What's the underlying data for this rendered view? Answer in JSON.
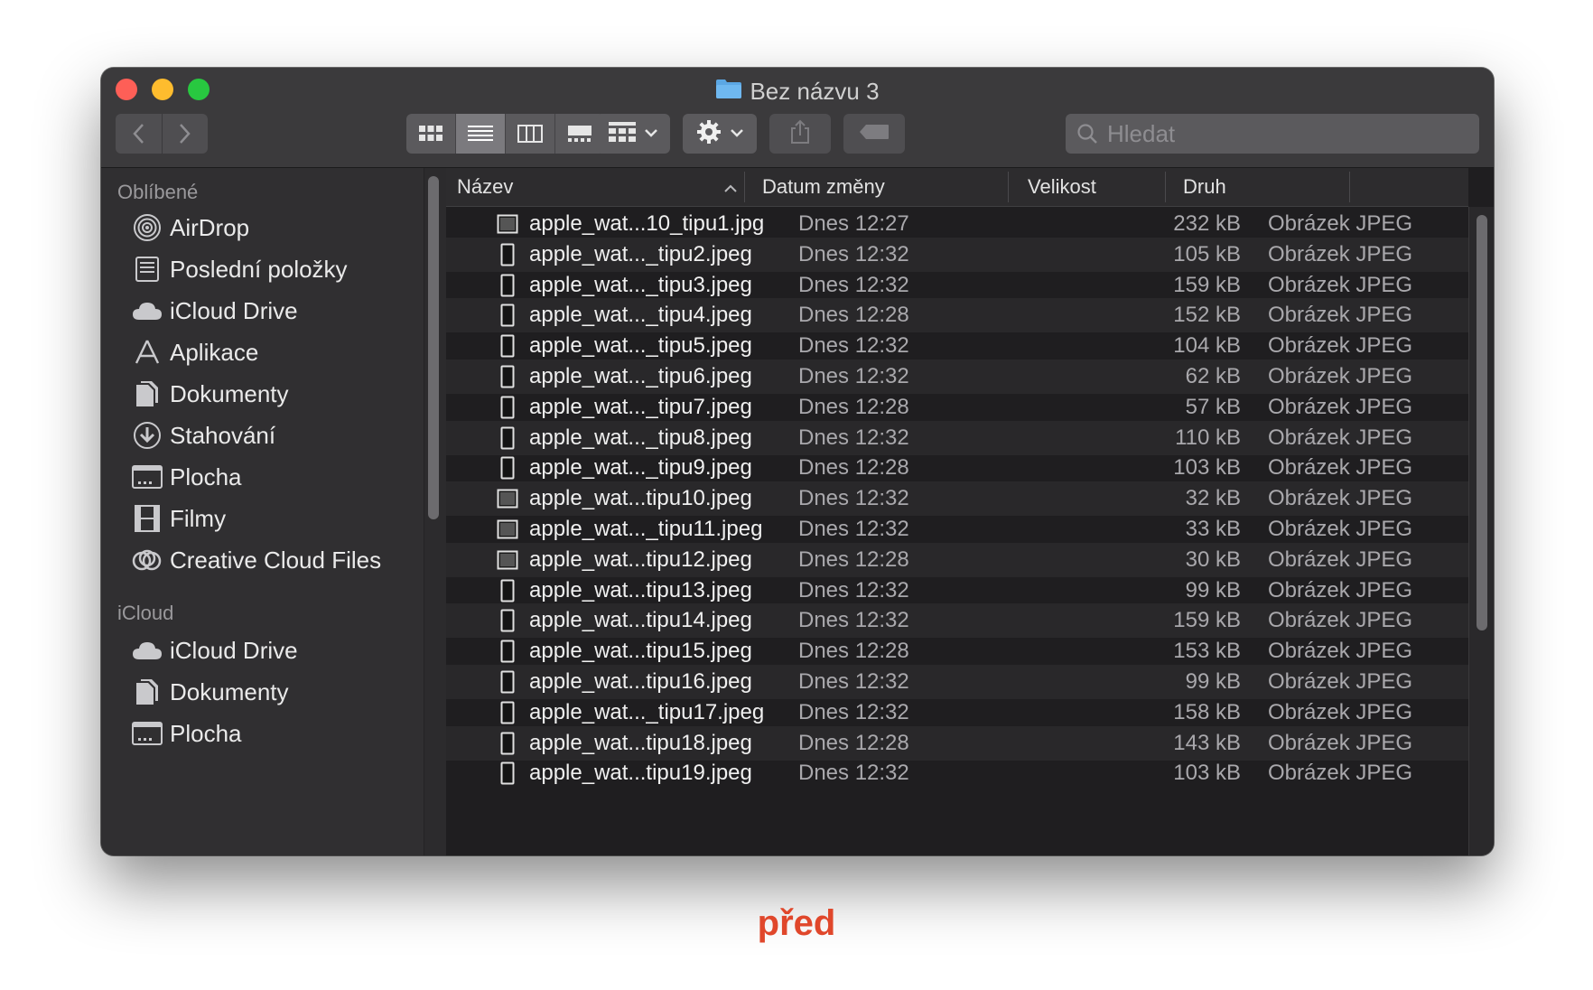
{
  "window": {
    "title": "Bez názvu 3"
  },
  "toolbar": {
    "back_icon": "chevron-left-icon",
    "forward_icon": "chevron-right-icon",
    "view_icons": [
      "grid-icon",
      "list-icon",
      "columns-icon",
      "gallery-icon"
    ],
    "group_icon": "group-grid-icon",
    "action_icon": "gear-icon",
    "share_icon": "share-icon",
    "tag_icon": "tag-icon"
  },
  "search": {
    "placeholder": "Hledat",
    "icon": "search-icon"
  },
  "sidebar": {
    "favorites_header": "Oblíbené",
    "favorites": [
      {
        "label": "AirDrop",
        "icon": "airdrop-icon"
      },
      {
        "label": "Poslední položky",
        "icon": "recents-icon"
      },
      {
        "label": "iCloud Drive",
        "icon": "cloud-icon"
      },
      {
        "label": "Aplikace",
        "icon": "applications-icon"
      },
      {
        "label": "Dokumenty",
        "icon": "documents-icon"
      },
      {
        "label": "Stahování",
        "icon": "download-icon"
      },
      {
        "label": "Plocha",
        "icon": "desktop-icon"
      },
      {
        "label": "Filmy",
        "icon": "movies-icon"
      },
      {
        "label": "Creative Cloud Files",
        "icon": "creative-cloud-icon"
      }
    ],
    "icloud_header": "iCloud",
    "icloud": [
      {
        "label": "iCloud Drive",
        "icon": "cloud-icon"
      },
      {
        "label": "Dokumenty",
        "icon": "documents-icon"
      },
      {
        "label": "Plocha",
        "icon": "desktop-icon"
      }
    ]
  },
  "table": {
    "columns": {
      "name": "Název",
      "date": "Datum změny",
      "size": "Velikost",
      "kind": "Druh"
    },
    "rows": [
      {
        "name": "apple_wat...10_tipu1.jpg",
        "date": "Dnes 12:27",
        "size": "232 kB",
        "kind": "Obrázek JPEG"
      },
      {
        "name": "apple_wat..._tipu2.jpeg",
        "date": "Dnes 12:32",
        "size": "105 kB",
        "kind": "Obrázek JPEG"
      },
      {
        "name": "apple_wat..._tipu3.jpeg",
        "date": "Dnes 12:32",
        "size": "159 kB",
        "kind": "Obrázek JPEG"
      },
      {
        "name": "apple_wat..._tipu4.jpeg",
        "date": "Dnes 12:28",
        "size": "152 kB",
        "kind": "Obrázek JPEG"
      },
      {
        "name": "apple_wat..._tipu5.jpeg",
        "date": "Dnes 12:32",
        "size": "104 kB",
        "kind": "Obrázek JPEG"
      },
      {
        "name": "apple_wat..._tipu6.jpeg",
        "date": "Dnes 12:32",
        "size": "62 kB",
        "kind": "Obrázek JPEG"
      },
      {
        "name": "apple_wat..._tipu7.jpeg",
        "date": "Dnes 12:28",
        "size": "57 kB",
        "kind": "Obrázek JPEG"
      },
      {
        "name": "apple_wat..._tipu8.jpeg",
        "date": "Dnes 12:32",
        "size": "110 kB",
        "kind": "Obrázek JPEG"
      },
      {
        "name": "apple_wat..._tipu9.jpeg",
        "date": "Dnes 12:28",
        "size": "103 kB",
        "kind": "Obrázek JPEG"
      },
      {
        "name": "apple_wat...tipu10.jpeg",
        "date": "Dnes 12:32",
        "size": "32 kB",
        "kind": "Obrázek JPEG"
      },
      {
        "name": "apple_wat..._tipu11.jpeg",
        "date": "Dnes 12:32",
        "size": "33 kB",
        "kind": "Obrázek JPEG"
      },
      {
        "name": "apple_wat...tipu12.jpeg",
        "date": "Dnes 12:28",
        "size": "30 kB",
        "kind": "Obrázek JPEG"
      },
      {
        "name": "apple_wat...tipu13.jpeg",
        "date": "Dnes 12:32",
        "size": "99 kB",
        "kind": "Obrázek JPEG"
      },
      {
        "name": "apple_wat...tipu14.jpeg",
        "date": "Dnes 12:32",
        "size": "159 kB",
        "kind": "Obrázek JPEG"
      },
      {
        "name": "apple_wat...tipu15.jpeg",
        "date": "Dnes 12:28",
        "size": "153 kB",
        "kind": "Obrázek JPEG"
      },
      {
        "name": "apple_wat...tipu16.jpeg",
        "date": "Dnes 12:32",
        "size": "99 kB",
        "kind": "Obrázek JPEG"
      },
      {
        "name": "apple_wat..._tipu17.jpeg",
        "date": "Dnes 12:32",
        "size": "158 kB",
        "kind": "Obrázek JPEG"
      },
      {
        "name": "apple_wat...tipu18.jpeg",
        "date": "Dnes 12:28",
        "size": "143 kB",
        "kind": "Obrázek JPEG"
      },
      {
        "name": "apple_wat...tipu19.jpeg",
        "date": "Dnes 12:32",
        "size": "103 kB",
        "kind": "Obrázek JPEG"
      }
    ]
  },
  "caption": "před",
  "colors": {
    "caption": "#e0472b",
    "close": "#fe5f57",
    "minimize": "#febc2e",
    "zoom": "#28c840"
  }
}
